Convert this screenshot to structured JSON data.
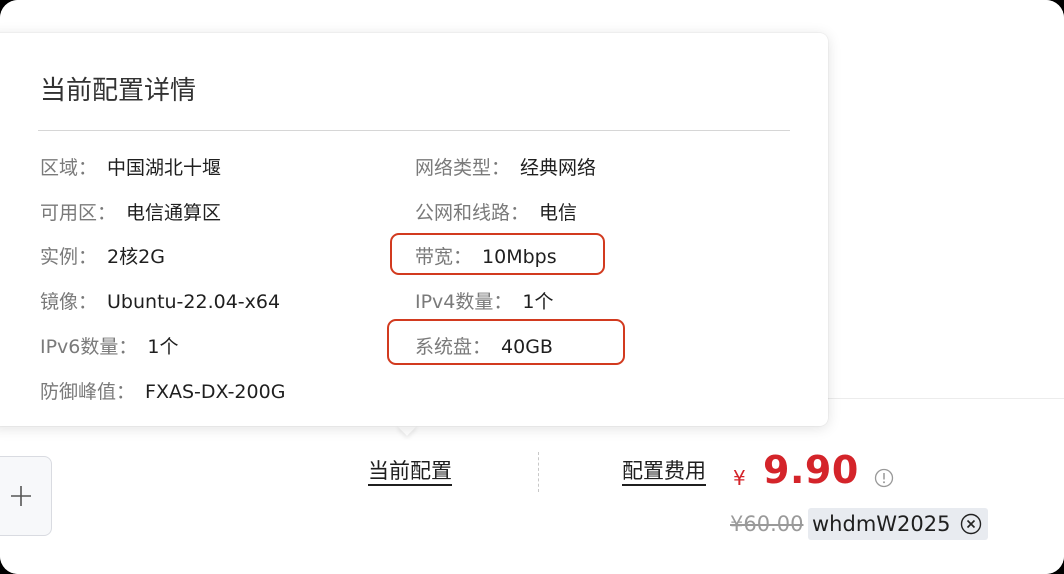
{
  "popover": {
    "title": "当前配置详情",
    "left_rows": [
      {
        "key": "区域：",
        "value": "中国湖北十堰"
      },
      {
        "key": "可用区：",
        "value": "电信通算区"
      },
      {
        "key": "实例：",
        "value": "2核2G"
      },
      {
        "key": "镜像：",
        "value": "Ubuntu-22.04-x64"
      },
      {
        "key": "IPv6数量：",
        "value": "1个"
      },
      {
        "key": "防御峰值：",
        "value": "FXAS-DX-200G"
      }
    ],
    "right_rows": [
      {
        "key": "网络类型：",
        "value": "经典网络"
      },
      {
        "key": "公网和线路：",
        "value": "电信"
      },
      {
        "key": "带宽：",
        "value": "10Mbps"
      },
      {
        "key": "IPv4数量：",
        "value": "1个"
      },
      {
        "key": "系统盘：",
        "value": "40GB"
      }
    ]
  },
  "footer": {
    "current_config_label": "当前配置",
    "config_fee_label": "配置费用",
    "currency": "¥",
    "price": "9.90",
    "original_price": "¥60.00",
    "coupon_code": "whdmW2025"
  },
  "colors": {
    "price": "#d4242a",
    "highlight": "#d23a1f"
  },
  "icons": [
    "plus-icon",
    "info-icon",
    "close-circle-icon"
  ]
}
